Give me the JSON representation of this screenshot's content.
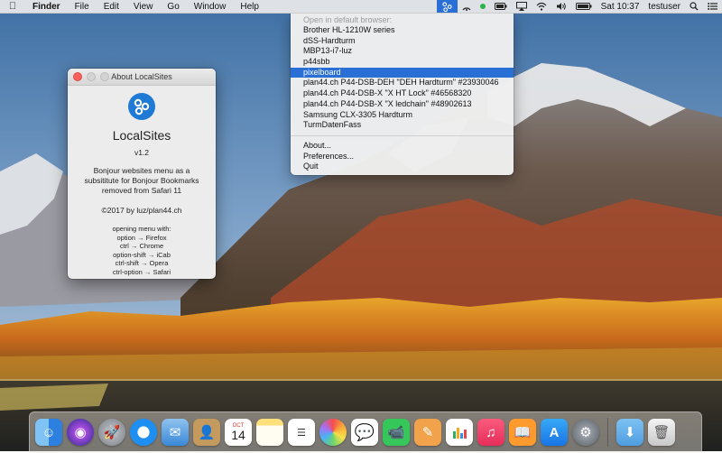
{
  "menubar": {
    "apple_icon": "apple-logo",
    "app_name": "Finder",
    "menus": [
      "File",
      "Edit",
      "View",
      "Go",
      "Window",
      "Help"
    ],
    "status": {
      "clock": "Sat 10:37",
      "user": "testuser"
    }
  },
  "about_window": {
    "title": "About LocalSites",
    "app_name": "LocalSites",
    "version": "v1.2",
    "description_lines": [
      "Bonjour websites menu as a",
      "subsititute for Bonjour Bookmarks",
      "removed from Safari 11"
    ],
    "copyright": "©2017 by luz/plan44.ch",
    "hints": [
      "opening menu with:",
      "option → Firefox",
      "ctrl → Chrome",
      "option-shift → iCab",
      "ctrl-shift → Opera",
      "ctrl-option → Safari"
    ]
  },
  "dropdown": {
    "header": "Open in default browser:",
    "sites": [
      "Brother HL-1210W series",
      "dSS-Hardturm",
      "MBP13-i7-luz",
      "p44sbb",
      "pixelboard",
      "plan44.ch P44-DSB-DEH \"DEH Hardturm\" #23930046",
      "plan44.ch P44-DSB-X \"X HT Lock\" #46568320",
      "plan44.ch P44-DSB-X \"X ledchain\" #48902613",
      "Samsung CLX-3305 Hardturm",
      "TurmDatenFass"
    ],
    "selected_index": 4,
    "actions": [
      "About...",
      "Preferences...",
      "Quit"
    ]
  },
  "dock": {
    "apps": [
      "finder",
      "siri",
      "launchpad",
      "safari",
      "mail",
      "contacts",
      "calendar",
      "notes",
      "reminders",
      "photos",
      "messages",
      "facetime",
      "pages",
      "numbers",
      "music",
      "books",
      "app-store",
      "system-preferences"
    ],
    "calendar_month": "OCT",
    "calendar_day": "14",
    "trailing": [
      "downloads-folder",
      "trash"
    ]
  },
  "colors": {
    "accent": "#2a6fd6",
    "app_icon": "#1f7ad6"
  }
}
